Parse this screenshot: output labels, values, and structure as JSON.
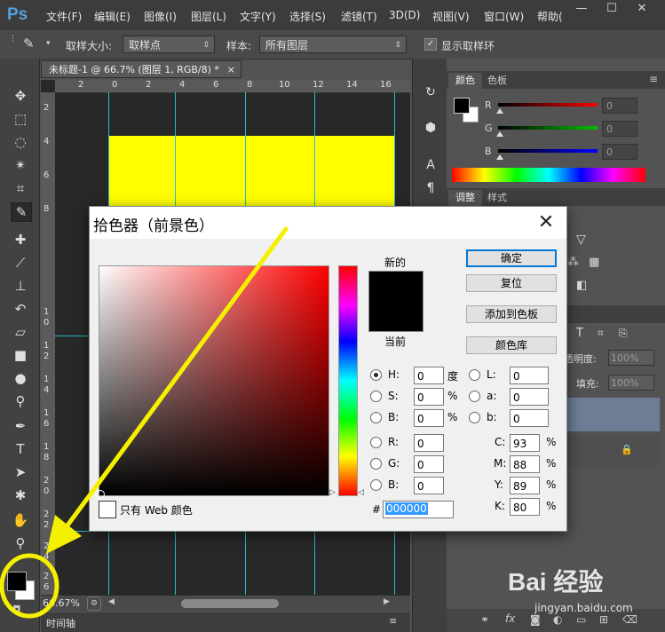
{
  "app": {
    "logo": "Ps"
  },
  "menubar": {
    "items": [
      "文件(F)",
      "编辑(E)",
      "图像(I)",
      "图层(L)",
      "文字(Y)",
      "选择(S)",
      "滤镜(T)",
      "3D(D)",
      "视图(V)",
      "窗口(W)",
      "帮助("
    ],
    "window_buttons": [
      "—",
      "☐",
      "✕"
    ]
  },
  "options_bar": {
    "sample_size_label": "取样大小:",
    "sample_size_value": "取样点",
    "sample_label": "样本:",
    "sample_value": "所有图层",
    "show_ring_label": "显示取样环"
  },
  "document": {
    "tab_title": "未标题-1 @ 66.7% (图层 1, RGB/8) *",
    "tab_close": "×",
    "ruler_top": [
      "2",
      "0",
      "2",
      "4",
      "6",
      "8",
      "10",
      "12",
      "14",
      "16"
    ],
    "ruler_left": [
      "2",
      "4",
      "6",
      "8",
      "1 0",
      "1 2",
      "1 4",
      "1 6",
      "1 8",
      "2 0",
      "2 2",
      "2 4",
      "2 6"
    ],
    "zoom": "66.67%",
    "timeline_label": "时间轴"
  },
  "color_panel": {
    "tabs": [
      "颜色",
      "色板"
    ],
    "channels": [
      {
        "label": "R",
        "value": "0",
        "color": "#ff0000"
      },
      {
        "label": "G",
        "value": "0",
        "color": "#00c000"
      },
      {
        "label": "B",
        "value": "0",
        "color": "#0000ff"
      }
    ]
  },
  "adjust_panel": {
    "tabs": [
      "调整",
      "样式"
    ]
  },
  "layers_panel": {
    "opacity_label": "透明度:",
    "opacity_value": "100%",
    "fill_label": "填充:",
    "fill_value": "100%"
  },
  "color_picker": {
    "title": "拾色器（前景色）",
    "new_label": "新的",
    "current_label": "当前",
    "new_color": "#000000",
    "current_color": "#000000",
    "buttons": {
      "ok": "确定",
      "reset": "复位",
      "add_swatch": "添加到色板",
      "libraries": "颜色库"
    },
    "web_only_label": "只有 Web 颜色",
    "hsb": [
      {
        "label": "H:",
        "value": "0",
        "unit": "度"
      },
      {
        "label": "S:",
        "value": "0",
        "unit": "%"
      },
      {
        "label": "B:",
        "value": "0",
        "unit": "%"
      }
    ],
    "rgb": [
      {
        "label": "R:",
        "value": "0"
      },
      {
        "label": "G:",
        "value": "0"
      },
      {
        "label": "B:",
        "value": "0"
      }
    ],
    "lab": [
      {
        "label": "L:",
        "value": "0"
      },
      {
        "label": "a:",
        "value": "0"
      },
      {
        "label": "b:",
        "value": "0"
      }
    ],
    "cmyk": [
      {
        "label": "C:",
        "value": "93",
        "unit": "%"
      },
      {
        "label": "M:",
        "value": "88",
        "unit": "%"
      },
      {
        "label": "Y:",
        "value": "89",
        "unit": "%"
      },
      {
        "label": "K:",
        "value": "80",
        "unit": "%"
      }
    ],
    "hex_label": "#",
    "hex_value": "000000"
  },
  "watermark": {
    "brand": "Bai 经验",
    "url": "jingyan.baidu.com"
  },
  "colors": {
    "annotation": "#f5f000",
    "guide": "#29b8d4",
    "canvas_fill": "#ffff00"
  }
}
